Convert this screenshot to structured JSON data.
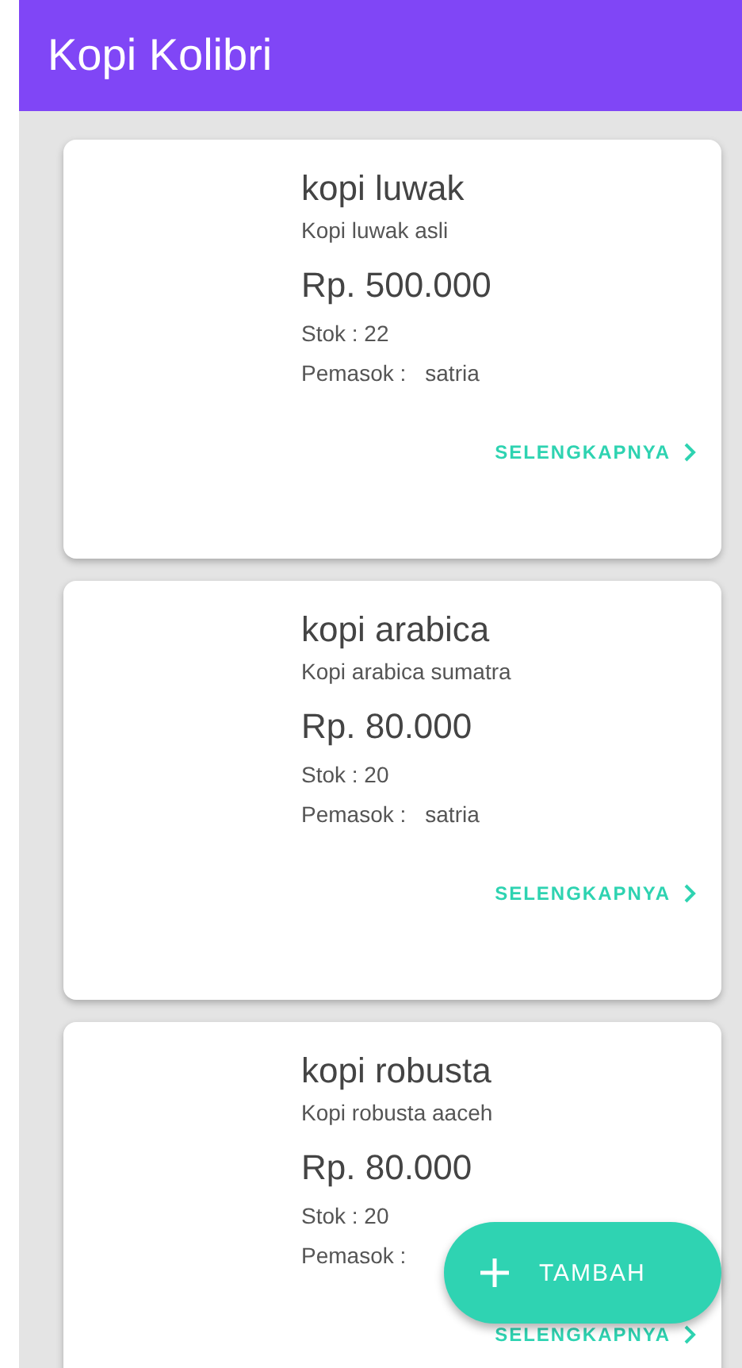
{
  "app_bar": {
    "title": "Kopi Kolibri"
  },
  "products": [
    {
      "name": "kopi luwak",
      "description": "Kopi luwak asli",
      "price": "Rp. 500.000",
      "stock": "Stok : 22",
      "supplier_label": "Pemasok :",
      "supplier": "satria",
      "link": "SELENGKAPNYA"
    },
    {
      "name": "kopi arabica",
      "description": "Kopi arabica sumatra",
      "price": "Rp. 80.000",
      "stock": "Stok : 20",
      "supplier_label": "Pemasok :",
      "supplier": "satria",
      "link": "SELENGKAPNYA"
    },
    {
      "name": "kopi robusta",
      "description": "Kopi robusta aaceh",
      "price": "Rp. 80.000",
      "stock": "Stok : 20",
      "supplier_label": "Pemasok :",
      "link": "SELENGKAPNYA"
    }
  ],
  "fab": {
    "label": "TAMBAH"
  }
}
